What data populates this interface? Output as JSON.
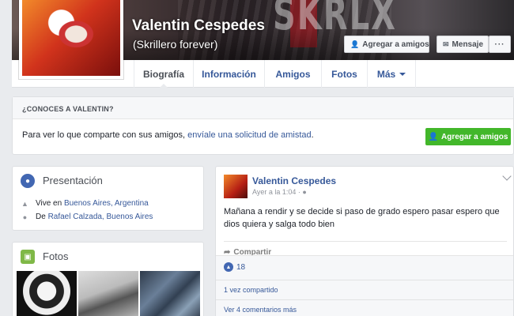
{
  "profile": {
    "name": "Valentin Cespedes",
    "nickname": "(Skrillero forever)"
  },
  "cover_actions": {
    "add_friend": "Agregar a amigos",
    "message": "Mensaje",
    "more": "···"
  },
  "nav": {
    "tabs": [
      {
        "label": "Biografía"
      },
      {
        "label": "Información"
      },
      {
        "label": "Amigos"
      },
      {
        "label": "Fotos"
      },
      {
        "label": "Más"
      }
    ]
  },
  "know": {
    "heading": "¿CONOCES A VALENTIN?",
    "text_prefix": "Para ver lo que comparte con sus amigos, ",
    "link": "envíale una solicitud de amistad",
    "text_suffix": ".",
    "button": "Agregar a amigos"
  },
  "intro": {
    "title": "Presentación",
    "lines": [
      {
        "prefix": "Vive en ",
        "link": "Buenos Aires, Argentina"
      },
      {
        "prefix": "De ",
        "link": "Rafael Calzada, Buenos Aires"
      }
    ]
  },
  "photos": {
    "title": "Fotos"
  },
  "post": {
    "author": "Valentin Cespedes",
    "time": "Ayer a la 1:04 ·",
    "text": "Mañana a rendir y se decide si paso de grado espero pasar espero que dios quiera y salga todo bien",
    "share_label": "Compartir",
    "likes": "18",
    "shared": "1 vez compartido",
    "more_comments": "Ver 4 comentarios más"
  },
  "colors": {
    "link": "#365899",
    "green_button": "#42b72a",
    "background": "#e9ebee"
  }
}
